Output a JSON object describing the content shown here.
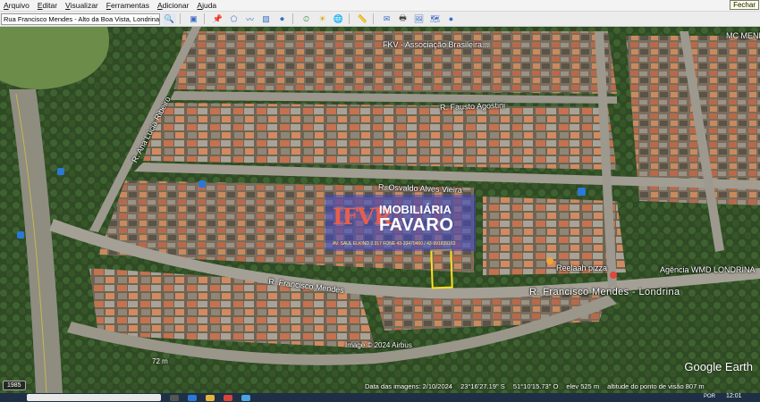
{
  "window": {
    "close_tooltip": "Fechar"
  },
  "menu": [
    "Arquivo",
    "Editar",
    "Visualizar",
    "Ferramentas",
    "Adicionar",
    "Ajuda"
  ],
  "toolbar": {
    "search_value": "Rua Francisco Mendes - Alto da Boa Vista, Londrina - PR",
    "buttons": [
      {
        "icon": "search-icon",
        "glyph": "🔍"
      },
      {
        "icon": "sidebar-toggle-icon",
        "glyph": "▣"
      },
      {
        "icon": "placemark-icon",
        "glyph": "📌"
      },
      {
        "icon": "polygon-icon",
        "glyph": "⬠"
      },
      {
        "icon": "path-icon",
        "glyph": "〰"
      },
      {
        "icon": "overlay-icon",
        "glyph": "▨"
      },
      {
        "icon": "tour-icon",
        "glyph": "⏺"
      },
      {
        "icon": "historical-imagery-icon",
        "glyph": "⏲"
      },
      {
        "icon": "sunlight-icon",
        "glyph": "☀"
      },
      {
        "icon": "planet-icon",
        "glyph": "🌐"
      },
      {
        "icon": "ruler-icon",
        "glyph": "📏"
      },
      {
        "icon": "email-icon",
        "glyph": "✉"
      },
      {
        "icon": "print-icon",
        "glyph": "🖶"
      },
      {
        "icon": "save-image-icon",
        "glyph": "🖼"
      },
      {
        "icon": "maps-icon",
        "glyph": "🗺"
      },
      {
        "icon": "earth-icon",
        "glyph": "●"
      }
    ]
  },
  "map": {
    "labels": {
      "street_top": "R. Fausto Agostini",
      "street_left_diag": "R. Ana Lúcia Ribeiro",
      "street_middle": "R. Osvaldo Alves Vieira",
      "street_lower": "R. Francisco Mendes",
      "street_main": "R. Francisco Mendes - Londrina",
      "poi_top": "FKV - Associação Brasileira...",
      "poi_top_right": "MC MEND",
      "poi_pizza": "Reelaah pizza",
      "poi_agencia": "Agência WMD LONDRINA",
      "image_credit": "Image © 2024 Airbus"
    },
    "watermark": {
      "logo": "IFVR",
      "name_line1": "IMOBILIÁRIA",
      "name_line2": "FAVARO",
      "contact": "AV. SAUL ELKIND 3.317 FONE 43-33470460 / 43-991839163"
    }
  },
  "status": {
    "scale": "72 m",
    "date": "Data das imagens: 2/10/2024",
    "lat": "23°16'27.19\" S",
    "lon": "51°10'15.73\" O",
    "elev": "elev   525 m",
    "altitude": "altitude do ponto de visão  807 m",
    "year_chip": "1985",
    "logo": "Google Earth"
  },
  "taskbar": {
    "lang": "POR",
    "time": "12:01"
  }
}
